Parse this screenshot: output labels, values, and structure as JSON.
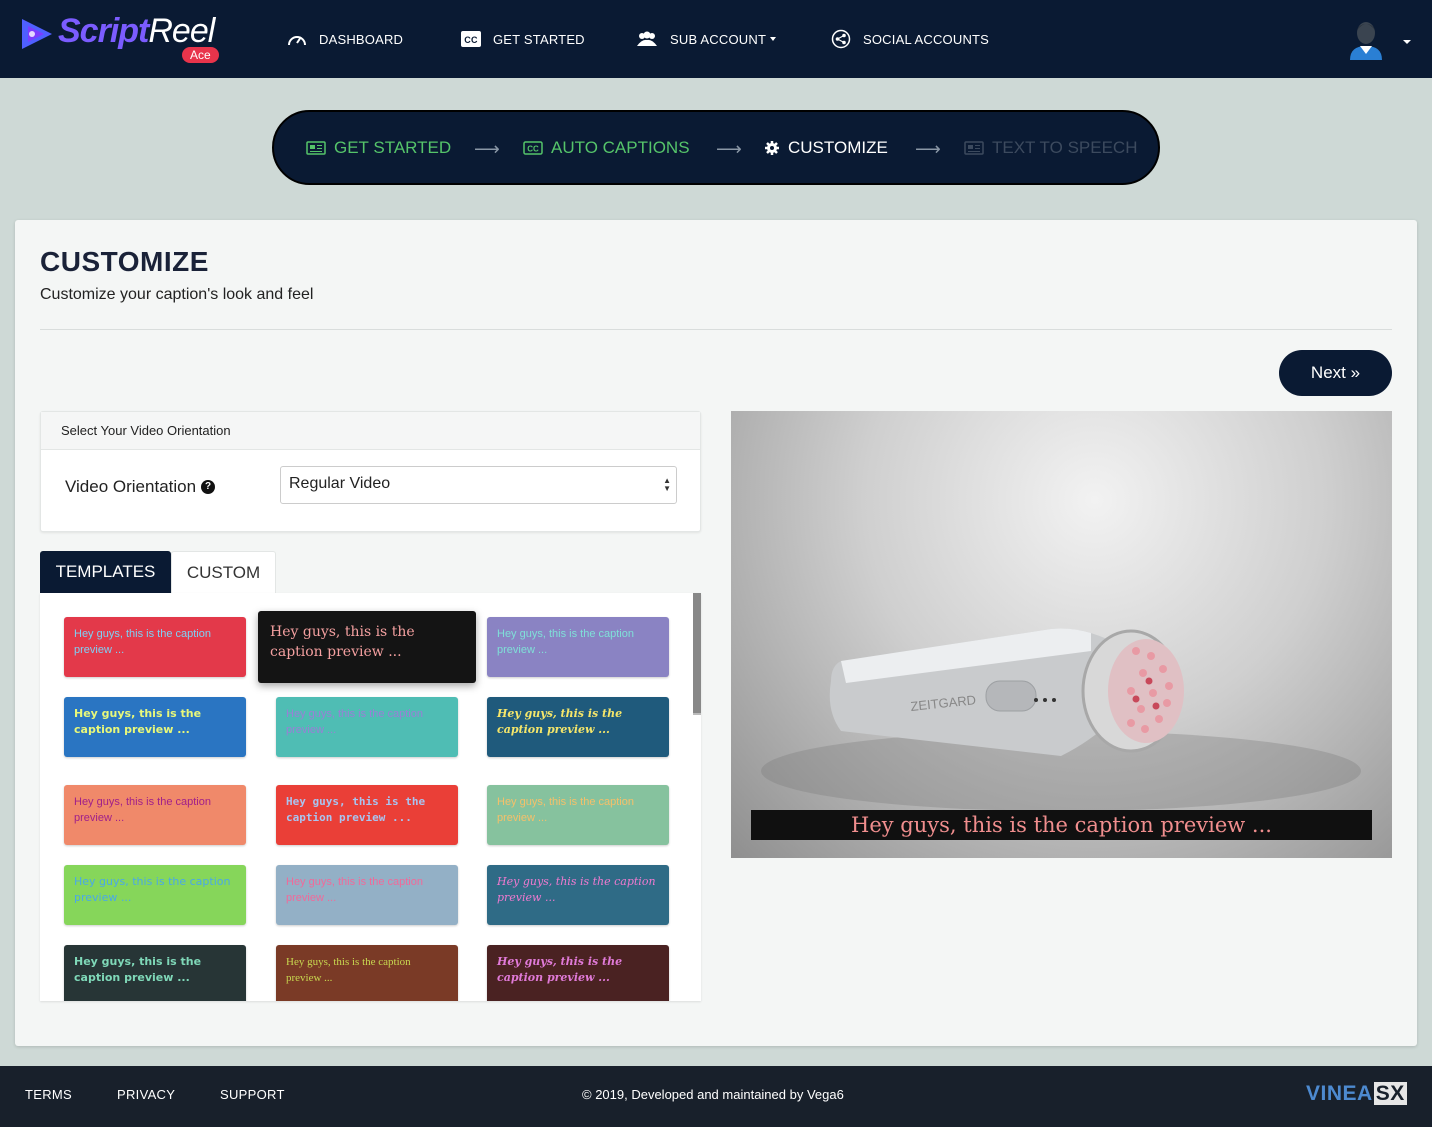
{
  "app": {
    "logo_script": "Script",
    "logo_reel": "Reel",
    "logo_badge": "Ace"
  },
  "nav": {
    "items": [
      {
        "label": "DASHBOARD",
        "icon": "dashboard-icon"
      },
      {
        "label": "GET STARTED",
        "icon": "cc-icon"
      },
      {
        "label": "SUB ACCOUNT",
        "icon": "users-icon"
      },
      {
        "label": "SOCIAL ACCOUNTS",
        "icon": "share-icon"
      }
    ]
  },
  "stepper": {
    "steps": [
      {
        "label": "GET STARTED",
        "state": "done",
        "icon": "newspaper-icon"
      },
      {
        "label": "AUTO CAPTIONS",
        "state": "done",
        "icon": "cc-icon"
      },
      {
        "label": "CUSTOMIZE",
        "state": "active",
        "icon": "gear-icon"
      },
      {
        "label": "TEXT TO SPEECH",
        "state": "todo",
        "icon": "newspaper-icon"
      }
    ],
    "arrow": "⟶",
    "colors": {
      "done": "#55c46a",
      "active": "#ffffff",
      "todo": "#3c4a5e"
    }
  },
  "page": {
    "title": "CUSTOMIZE",
    "subtitle": "Customize your caption's look and feel",
    "next_label": "Next »"
  },
  "orientation": {
    "header": "Select Your Video Orientation",
    "label": "Video Orientation",
    "help": "?",
    "selected": "Regular Video"
  },
  "tabs": {
    "templates": "TEMPLATES",
    "custom": "CUSTOM"
  },
  "templates": {
    "hover_text": "Hey guys, this is the caption preview ...",
    "items": [
      {
        "text": "Hey guys, this is the caption preview ...",
        "bg": "#e3394a",
        "fg": "#7fd1f5"
      },
      {
        "text": "Hey guys, this is the caption preview ...",
        "bg": "#e8505a",
        "fg": "#ffffff"
      },
      {
        "text": "Hey guys, this is the caption preview ...",
        "bg": "#8a83c3",
        "fg": "#7fe0d8"
      },
      {
        "text": "Hey guys, this is the caption preview ...",
        "bg": "#2a75c2",
        "fg": "#e8f87a"
      },
      {
        "text": "Hey guys, this is the caption preview ...",
        "bg": "#4fbdb4",
        "fg": "#9a7fd6"
      },
      {
        "text": "Hey guys, this is the caption preview ...",
        "bg": "#1f5a7c",
        "fg": "#f5e66a"
      },
      {
        "text": "Hey guys, this is the caption preview ...",
        "bg": "#f0896a",
        "fg": "#a0208a"
      },
      {
        "text": "Hey guys, this is the caption preview ...",
        "bg": "#ea3f37",
        "fg": "#a9c4f0"
      },
      {
        "text": "Hey guys, this is the caption preview ...",
        "bg": "#86c29e",
        "fg": "#f5c06a"
      },
      {
        "text": "Hey guys, this is the caption preview ...",
        "bg": "#86d65a",
        "fg": "#4aa8e8"
      },
      {
        "text": "Hey guys, this is the caption preview ...",
        "bg": "#93b0c6",
        "fg": "#f06a9a"
      },
      {
        "text": "Hey guys, this is the caption preview ...",
        "bg": "#2f6b86",
        "fg": "#f07ad0"
      },
      {
        "text": "Hey guys, this is the caption preview ...",
        "bg": "#273536",
        "fg": "#7fd8b8"
      },
      {
        "text": "Hey guys, this is the caption preview ...",
        "bg": "#7a3a26",
        "fg": "#c8d850"
      },
      {
        "text": "Hey guys, this is the caption preview ...",
        "bg": "#4a2222",
        "fg": "#e07ad8"
      }
    ]
  },
  "preview": {
    "caption": "Hey guys, this is the caption preview ...",
    "product_brand": "ZEITGARD",
    "caption_bg": "#101010",
    "caption_fg": "#f08e8e"
  },
  "footer": {
    "links": [
      "TERMS",
      "PRIVACY",
      "SUPPORT"
    ],
    "copyright": "© 2019, Developed and maintained by Vega6",
    "brand_a": "VINEA",
    "brand_b": "SX"
  }
}
